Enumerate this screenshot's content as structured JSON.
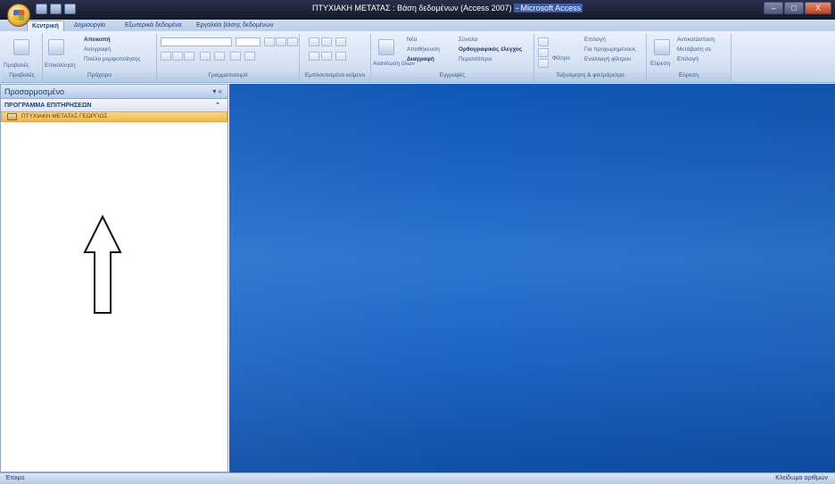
{
  "window": {
    "title_prefix": "ΠΤΥΧΙΑΚΗ ΜΕΤΑΤΑΣ : Βάση δεδομένων (Access 2007)",
    "title_suffix": "- Microsoft Access",
    "minimize": "–",
    "maximize": "□",
    "close": "X"
  },
  "tabs": [
    {
      "label": "Κεντρική"
    },
    {
      "label": "Δημιουργία"
    },
    {
      "label": "Εξωτερικά δεδομένα"
    },
    {
      "label": "Εργαλεία βάσης δεδομένων"
    }
  ],
  "ribbon": {
    "views": {
      "button": "Προβολές",
      "group": "Προβολές"
    },
    "clipboard": {
      "paste": "Επικόλληση",
      "cut": "Αποκοπή",
      "copy": "Αντιγραφή",
      "format_painter": "Πινέλο μορφοποίησης",
      "group": "Πρόχειρο"
    },
    "font": {
      "group": "Γραμματοσειρά"
    },
    "rich_text": {
      "group": "Εμπλουτισμένο κείμενο"
    },
    "records": {
      "refresh": "Ανανέωση όλων",
      "new": "Νέα",
      "save": "Αποθήκευση",
      "delete": "Διαγραφή",
      "totals": "Σύνολα",
      "spelling": "Ορθογραφικός έλεγχος",
      "more": "Περισσότερα",
      "group": "Εγγραφές"
    },
    "sort_filter": {
      "filter": "Φίλτρο",
      "selection": "Επιλογή",
      "advanced": "Για προχωρημένους",
      "toggle_filter": "Εναλλαγή φίλτρου",
      "group": "Ταξινόμηση & φιλτράρισμα"
    },
    "find": {
      "find": "Εύρεση",
      "replace": "Αντικατάσταση",
      "goto": "Μετάβαση σε",
      "select": "Επιλογή",
      "group": "Εύρεση"
    }
  },
  "nav_pane": {
    "header": "Προσαρμοσμένο",
    "header_controls": "▾ «",
    "group_title": "ΠΡΟΓΡΑΜΜΑ ΕΠΙΤΗΡΗΣΕΩΝ",
    "group_collapse": "⌃",
    "items": [
      {
        "label": "ΠΤΥΧΙΑΚΗ ΜΕΤΑΤΑΣ ΓΕΩΡΓΙΟΣ"
      }
    ]
  },
  "status_bar": {
    "left": "Έτοιμο",
    "right": "Κλείδωμα αριθμών"
  },
  "colors": {
    "workspace": "#1a63c3",
    "selected_item": "#f4b64a",
    "ribbon": "#d6e3f4"
  }
}
